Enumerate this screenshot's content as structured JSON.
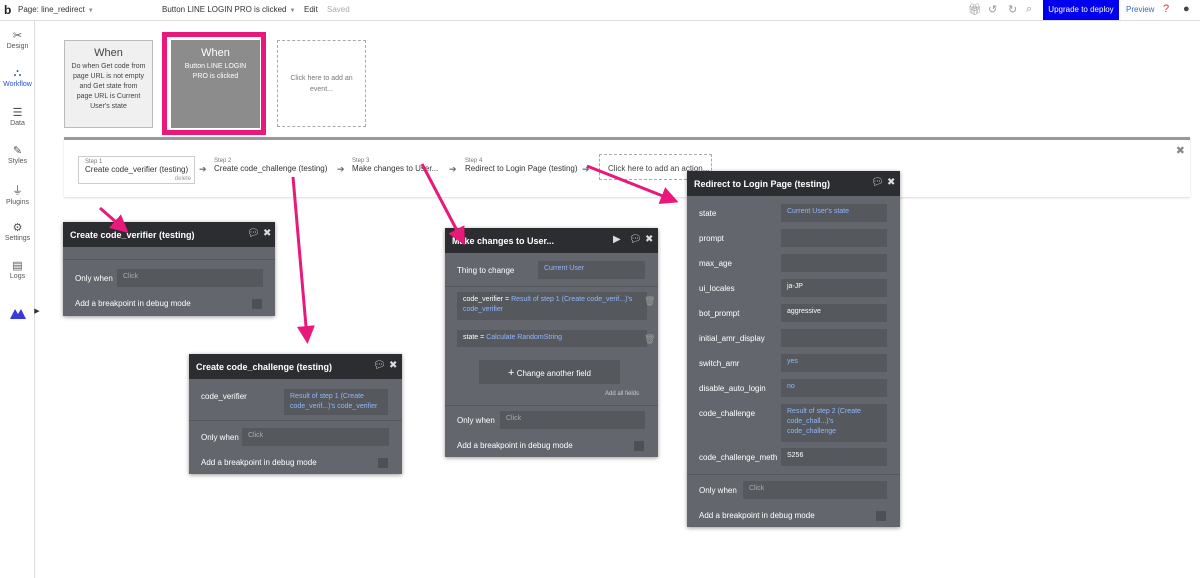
{
  "topbar": {
    "logo": "b",
    "page_label": "Page: line_redirect",
    "event_label": "Button LINE LOGIN PRO is clicked",
    "edit_label": "Edit",
    "saved_label": "Saved",
    "upgrade_label": "Upgrade to deploy",
    "preview_label": "Preview"
  },
  "sidebar": {
    "items": [
      {
        "label": "Design",
        "icon": "✂"
      },
      {
        "label": "Workflow",
        "icon": "⛬"
      },
      {
        "label": "Data",
        "icon": "☰"
      },
      {
        "label": "Styles",
        "icon": "✎"
      },
      {
        "label": "Plugins",
        "icon": "⏚"
      },
      {
        "label": "Settings",
        "icon": "⚙"
      },
      {
        "label": "Logs",
        "icon": "▤"
      }
    ]
  },
  "events": [
    {
      "when": "When",
      "desc": "Do when Get code from page URL is not empty and Get state from page URL is Current User's state"
    },
    {
      "when": "When",
      "desc": "Button LINE LOGIN PRO is clicked"
    }
  ],
  "add_event": "Click here to add an event...",
  "steps": [
    {
      "num": "Step 1",
      "title": "Create code_verifier (testing)",
      "delete": "delete"
    },
    {
      "num": "Step 2",
      "title": "Create code_challenge (testing)"
    },
    {
      "num": "Step 3",
      "title": "Make changes to User..."
    },
    {
      "num": "Step 4",
      "title": "Redirect to Login Page (testing)"
    }
  ],
  "add_action": "Click here to add an action...",
  "panel_verifier": {
    "title": "Create code_verifier (testing)",
    "only_when": "Only when",
    "click": "Click",
    "breakpoint": "Add a breakpoint in debug mode"
  },
  "panel_challenge": {
    "title": "Create code_challenge (testing)",
    "field_label": "code_verifier",
    "field_value": "Result of step 1 (Create code_verif...)'s code_verifier",
    "only_when": "Only when",
    "click": "Click",
    "breakpoint": "Add a breakpoint in debug mode"
  },
  "panel_changes": {
    "title": "Make changes to User...",
    "thing_label": "Thing to change",
    "thing_value": "Current User",
    "f1_label": "code_verifier =",
    "f1_value": "Result of step 1 (Create code_verif...)'s code_verifier",
    "f2_label": "state =",
    "f2_value": "Calculate RandomString",
    "change_btn": "Change another field",
    "add_all": "Add all fields",
    "only_when": "Only when",
    "click": "Click",
    "breakpoint": "Add a breakpoint in debug mode"
  },
  "panel_redirect": {
    "title": "Redirect to Login Page (testing)",
    "fields": [
      {
        "label": "state",
        "value": "Current User's state",
        "color": "blue"
      },
      {
        "label": "prompt",
        "value": "",
        "color": "white"
      },
      {
        "label": "max_age",
        "value": "",
        "color": "white"
      },
      {
        "label": "ui_locales",
        "value": "ja-JP",
        "color": "white"
      },
      {
        "label": "bot_prompt",
        "value": "aggressive",
        "color": "white"
      },
      {
        "label": "initial_amr_display",
        "value": "",
        "color": "white"
      },
      {
        "label": "switch_amr",
        "value": "yes",
        "color": "blue"
      },
      {
        "label": "disable_auto_login",
        "value": "no",
        "color": "blue"
      },
      {
        "label": "code_challenge",
        "value": "Result of step 2 (Create code_chall...)'s code_challenge",
        "color": "blue"
      },
      {
        "label": "code_challenge_meth",
        "value": "S256",
        "color": "white"
      }
    ],
    "only_when": "Only when",
    "click": "Click",
    "breakpoint": "Add a breakpoint in debug mode"
  },
  "colors": {
    "accent": "#0000ee",
    "highlight": "#e8197a",
    "panel": "#63676d",
    "panel_header": "#2b2d30",
    "link_blue": "#8fb7ff"
  }
}
